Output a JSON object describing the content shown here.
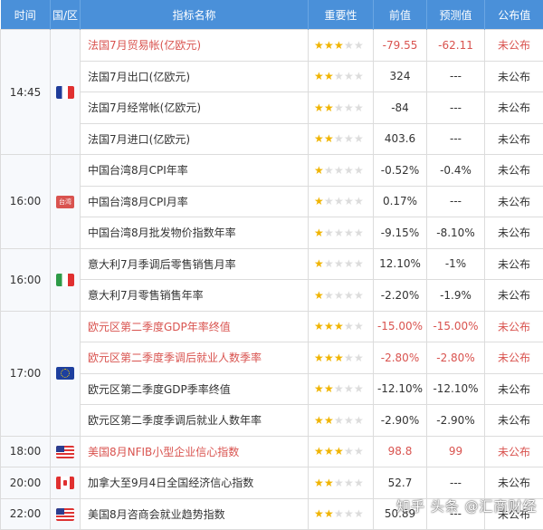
{
  "headers": [
    "时间",
    "国/区",
    "指标名称",
    "重要性",
    "前值",
    "预测值",
    "公布值"
  ],
  "colors": {
    "header_bg": "#4a90d9",
    "highlight": "#d9534f",
    "star_on": "#f0b400",
    "star_off": "#dcdcdc"
  },
  "groups": [
    {
      "time": "14:45",
      "flag": "france-flag-icon",
      "rows": [
        {
          "name": "法国7月贸易帐(亿欧元)",
          "stars": 3,
          "prev": "-79.55",
          "forecast": "-62.11",
          "actual": "未公布",
          "highlight": true
        },
        {
          "name": "法国7月出口(亿欧元)",
          "stars": 2,
          "prev": "324",
          "forecast": "---",
          "actual": "未公布",
          "highlight": false
        },
        {
          "name": "法国7月经常帐(亿欧元)",
          "stars": 2,
          "prev": "-84",
          "forecast": "---",
          "actual": "未公布",
          "highlight": false
        },
        {
          "name": "法国7月进口(亿欧元)",
          "stars": 2,
          "prev": "403.6",
          "forecast": "---",
          "actual": "未公布",
          "highlight": false
        }
      ]
    },
    {
      "time": "16:00",
      "flag": "taiwan-flag-icon",
      "flag_text": "台湾",
      "rows": [
        {
          "name": "中国台湾8月CPI年率",
          "stars": 1,
          "prev": "-0.52%",
          "forecast": "-0.4%",
          "actual": "未公布",
          "highlight": false
        },
        {
          "name": "中国台湾8月CPI月率",
          "stars": 1,
          "prev": "0.17%",
          "forecast": "---",
          "actual": "未公布",
          "highlight": false
        },
        {
          "name": "中国台湾8月批发物价指数年率",
          "stars": 1,
          "prev": "-9.15%",
          "forecast": "-8.10%",
          "actual": "未公布",
          "highlight": false
        }
      ]
    },
    {
      "time": "16:00",
      "flag": "italy-flag-icon",
      "rows": [
        {
          "name": "意大利7月季调后零售销售月率",
          "stars": 1,
          "prev": "12.10%",
          "forecast": "-1%",
          "actual": "未公布",
          "highlight": false
        },
        {
          "name": "意大利7月零售销售年率",
          "stars": 1,
          "prev": "-2.20%",
          "forecast": "-1.9%",
          "actual": "未公布",
          "highlight": false
        }
      ]
    },
    {
      "time": "17:00",
      "flag": "eu-flag-icon",
      "rows": [
        {
          "name": "欧元区第二季度GDP年率终值",
          "stars": 3,
          "prev": "-15.00%",
          "forecast": "-15.00%",
          "actual": "未公布",
          "highlight": true
        },
        {
          "name": "欧元区第二季度季调后就业人数季率",
          "stars": 3,
          "prev": "-2.80%",
          "forecast": "-2.80%",
          "actual": "未公布",
          "highlight": true
        },
        {
          "name": "欧元区第二季度GDP季率终值",
          "stars": 2,
          "prev": "-12.10%",
          "forecast": "-12.10%",
          "actual": "未公布",
          "highlight": false
        },
        {
          "name": "欧元区第二季度季调后就业人数年率",
          "stars": 2,
          "prev": "-2.90%",
          "forecast": "-2.90%",
          "actual": "未公布",
          "highlight": false
        }
      ]
    },
    {
      "time": "18:00",
      "flag": "us-flag-icon",
      "rows": [
        {
          "name": "美国8月NFIB小型企业信心指数",
          "stars": 3,
          "prev": "98.8",
          "forecast": "99",
          "actual": "未公布",
          "highlight": true
        }
      ]
    },
    {
      "time": "20:00",
      "flag": "canada-flag-icon",
      "rows": [
        {
          "name": "加拿大至9月4日全国经济信心指数",
          "stars": 2,
          "prev": "52.7",
          "forecast": "---",
          "actual": "未公布",
          "highlight": false
        }
      ]
    },
    {
      "time": "22:00",
      "flag": "us-flag-icon",
      "rows": [
        {
          "name": "美国8月咨商会就业趋势指数",
          "stars": 2,
          "prev": "50.89",
          "forecast": "---",
          "actual": "未公布",
          "highlight": false
        }
      ]
    }
  ],
  "watermark": "知乎 头条 @汇商财经"
}
